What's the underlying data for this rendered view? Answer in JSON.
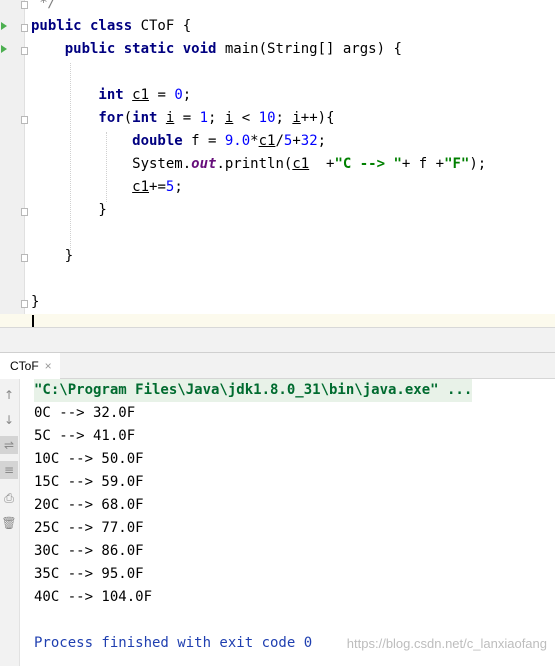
{
  "editor": {
    "lines": [
      {
        "id": "comment-end",
        "parts": [
          {
            "t": " */",
            "c": "cmt"
          }
        ]
      },
      {
        "id": "class-decl",
        "parts": [
          {
            "t": "public class ",
            "c": "kw"
          },
          {
            "t": "CToF {",
            "c": ""
          }
        ]
      },
      {
        "id": "main-decl",
        "parts": [
          {
            "t": "    public static void ",
            "c": "kw"
          },
          {
            "t": "main(String[] args) {",
            "c": ""
          }
        ]
      },
      {
        "id": "blank1",
        "parts": [
          {
            "t": "",
            "c": ""
          }
        ]
      },
      {
        "id": "int-decl",
        "parts": [
          {
            "t": "        int ",
            "c": "kw"
          },
          {
            "t": "c1",
            "c": "u"
          },
          {
            "t": " = ",
            "c": ""
          },
          {
            "t": "0",
            "c": "num"
          },
          {
            "t": ";",
            "c": ""
          }
        ]
      },
      {
        "id": "for-line",
        "parts": [
          {
            "t": "        for",
            "c": "kw"
          },
          {
            "t": "(",
            "c": ""
          },
          {
            "t": "int ",
            "c": "kw"
          },
          {
            "t": "i",
            "c": "u"
          },
          {
            "t": " = ",
            "c": ""
          },
          {
            "t": "1",
            "c": "num"
          },
          {
            "t": "; ",
            "c": ""
          },
          {
            "t": "i",
            "c": "u"
          },
          {
            "t": " < ",
            "c": ""
          },
          {
            "t": "10",
            "c": "num"
          },
          {
            "t": "; ",
            "c": ""
          },
          {
            "t": "i",
            "c": "u"
          },
          {
            "t": "++){",
            "c": ""
          }
        ]
      },
      {
        "id": "double-line",
        "parts": [
          {
            "t": "            double ",
            "c": "kw"
          },
          {
            "t": "f = ",
            "c": ""
          },
          {
            "t": "9.0",
            "c": "num"
          },
          {
            "t": "*",
            "c": ""
          },
          {
            "t": "c1",
            "c": "u"
          },
          {
            "t": "/",
            "c": ""
          },
          {
            "t": "5",
            "c": "num"
          },
          {
            "t": "+",
            "c": ""
          },
          {
            "t": "32",
            "c": "num"
          },
          {
            "t": ";",
            "c": ""
          }
        ]
      },
      {
        "id": "println-line",
        "parts": [
          {
            "t": "            System.",
            "c": ""
          },
          {
            "t": "out",
            "c": "fld"
          },
          {
            "t": ".println(",
            "c": ""
          },
          {
            "t": "c1",
            "c": "u"
          },
          {
            "t": "  +",
            "c": ""
          },
          {
            "t": "\"C --> \"",
            "c": "str"
          },
          {
            "t": "+ f +",
            "c": ""
          },
          {
            "t": "\"F\"",
            "c": "str"
          },
          {
            "t": ");",
            "c": ""
          }
        ]
      },
      {
        "id": "incr-line",
        "parts": [
          {
            "t": "            ",
            "c": ""
          },
          {
            "t": "c1",
            "c": "u"
          },
          {
            "t": "+=",
            "c": ""
          },
          {
            "t": "5",
            "c": "num"
          },
          {
            "t": ";",
            "c": ""
          }
        ]
      },
      {
        "id": "close-for",
        "parts": [
          {
            "t": "        }",
            "c": ""
          }
        ]
      },
      {
        "id": "blank2",
        "parts": [
          {
            "t": "",
            "c": ""
          }
        ]
      },
      {
        "id": "close-main",
        "parts": [
          {
            "t": "    }",
            "c": ""
          }
        ]
      },
      {
        "id": "blank3",
        "parts": [
          {
            "t": "",
            "c": ""
          }
        ]
      },
      {
        "id": "close-class",
        "parts": [
          {
            "t": "}",
            "c": ""
          }
        ]
      }
    ]
  },
  "run_tab": {
    "label": "CToF",
    "close": "×"
  },
  "console": {
    "command": "\"C:\\Program Files\\Java\\jdk1.8.0_31\\bin\\java.exe\" ...",
    "output": [
      "0C --> 32.0F",
      "5C --> 41.0F",
      "10C --> 50.0F",
      "15C --> 59.0F",
      "20C --> 68.0F",
      "25C --> 77.0F",
      "30C --> 86.0F",
      "35C --> 95.0F",
      "40C --> 104.0F"
    ],
    "finished": "Process finished with exit code 0"
  },
  "watermark": "https://blog.csdn.net/c_lanxiaofang",
  "icons": [
    "run-gutter-icon",
    "fold-marker-icon",
    "up-arrow-icon",
    "down-arrow-icon",
    "soft-wrap-icon",
    "scroll-to-end-icon",
    "print-icon",
    "trash-icon",
    "close-icon"
  ]
}
